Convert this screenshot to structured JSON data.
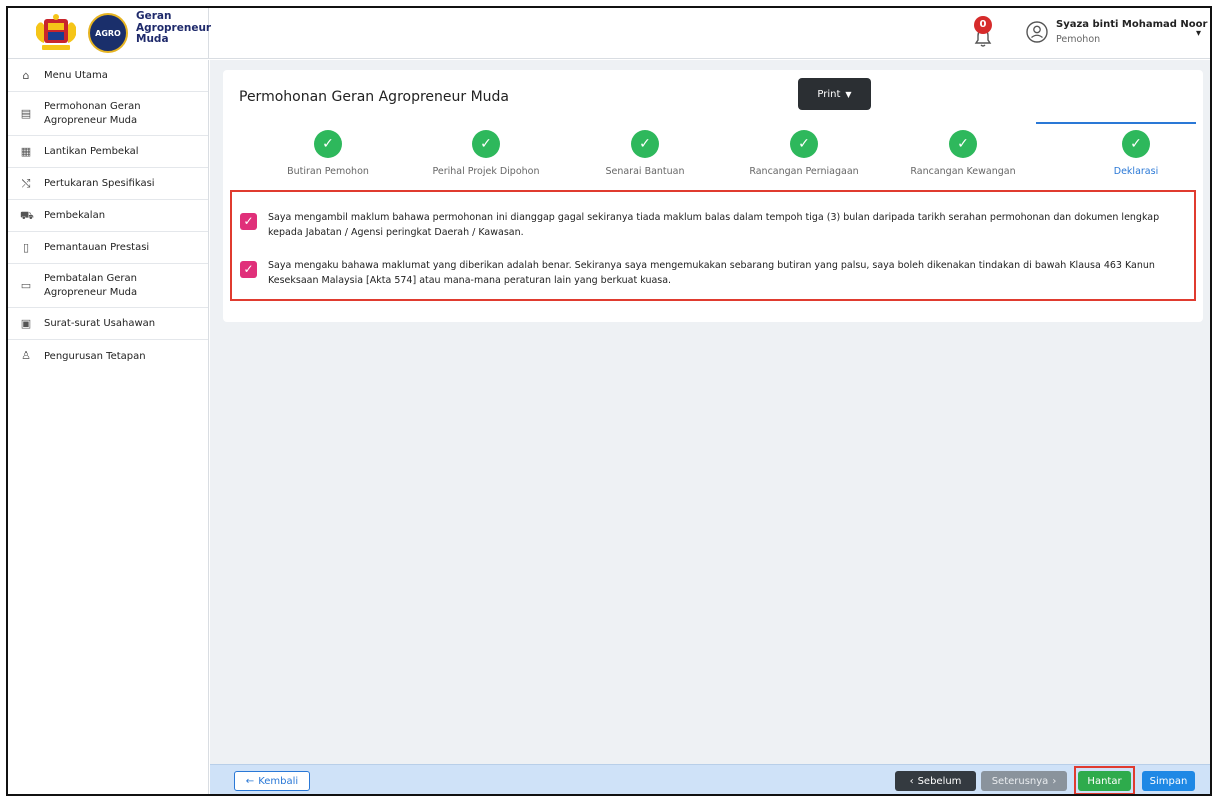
{
  "header": {
    "brand_line1": "Geran",
    "brand_line2": "Agropreneur",
    "brand_line3": "Muda",
    "agro_logo_text": "AGRO",
    "notification_count": "0",
    "user_name": "Syaza binti Mohamad Noor",
    "user_role": "Pemohon"
  },
  "sidebar": {
    "items": [
      {
        "label": "Menu Utama",
        "icon": "home-icon"
      },
      {
        "label": "Permohonan Geran Agropreneur Muda",
        "icon": "document-icon"
      },
      {
        "label": "Lantikan Pembekal",
        "icon": "store-icon"
      },
      {
        "label": "Pertukaran Spesifikasi",
        "icon": "shuffle-icon"
      },
      {
        "label": "Pembekalan",
        "icon": "truck-icon"
      },
      {
        "label": "Pemantauan Prestasi",
        "icon": "clipboard-icon"
      },
      {
        "label": "Pembatalan Geran Agropreneur Muda",
        "icon": "trash-icon"
      },
      {
        "label": "Surat-surat Usahawan",
        "icon": "mail-icon"
      },
      {
        "label": "Pengurusan Tetapan",
        "icon": "user-icon"
      }
    ]
  },
  "main": {
    "title": "Permohonan Geran Agropreneur Muda",
    "print_label": "Print",
    "steps": [
      {
        "label": "Butiran Pemohon"
      },
      {
        "label": "Perihal Projek Dipohon"
      },
      {
        "label": "Senarai Bantuan"
      },
      {
        "label": "Rancangan Perniagaan"
      },
      {
        "label": "Rancangan Kewangan"
      },
      {
        "label": "Deklarasi"
      }
    ],
    "declarations": [
      {
        "text": "Saya mengambil maklum bahawa permohonan ini dianggap gagal sekiranya tiada maklum balas dalam tempoh tiga (3) bulan daripada tarikh serahan permohonan dan dokumen lengkap kepada Jabatan / Agensi peringkat Daerah / Kawasan.",
        "checked": true
      },
      {
        "text": "Saya mengaku bahawa maklumat yang diberikan adalah benar. Sekiranya saya mengemukakan sebarang butiran yang palsu, saya boleh dikenakan tindakan di bawah Klausa 463 Kanun Keseksaan Malaysia [Akta 574] atau mana-mana peraturan lain yang berkuat kuasa.",
        "checked": true
      }
    ]
  },
  "footer": {
    "back_label": "Kembali",
    "prev_label": "Sebelum",
    "next_label": "Seterusnya",
    "submit_label": "Hantar",
    "save_label": "Simpan"
  },
  "colors": {
    "success": "#2eb85c",
    "active_step": "#2a78d6",
    "highlight_border": "#e03b2f",
    "checkbox": "#e0307a",
    "submit": "#2eab4c",
    "save": "#1e88e5"
  }
}
